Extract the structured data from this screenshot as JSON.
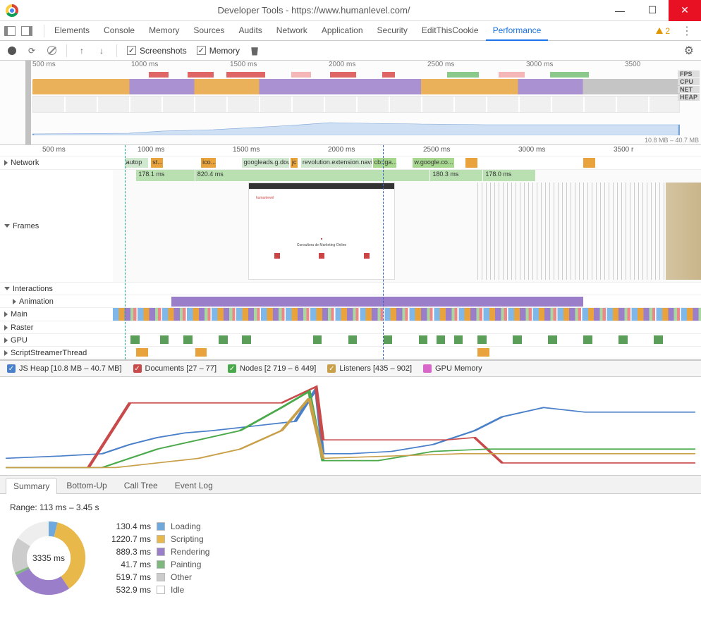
{
  "window": {
    "title": "Developer Tools - https://www.humanlevel.com/"
  },
  "tabs": {
    "items": [
      "Elements",
      "Console",
      "Memory",
      "Sources",
      "Audits",
      "Network",
      "Application",
      "Security",
      "EditThisCookie",
      "Performance"
    ],
    "active": "Performance",
    "warning_count": "2"
  },
  "toolbar": {
    "screenshots_label": "Screenshots",
    "memory_label": "Memory"
  },
  "overview": {
    "ticks": [
      "500 ms",
      "1000 ms",
      "1500 ms",
      "2000 ms",
      "2500 ms",
      "3000 ms",
      "3500"
    ],
    "lanes": [
      "FPS",
      "CPU",
      "NET",
      "HEAP"
    ],
    "heap_range": "10.8 MB – 40.7 MB"
  },
  "flame": {
    "ticks": [
      "500 ms",
      "1000 ms",
      "1500 ms",
      "2000 ms",
      "2500 ms",
      "3000 ms",
      "3500 r"
    ],
    "rows": {
      "network": "Network",
      "frames": "Frames",
      "interactions": "Interactions",
      "animation": "Animation",
      "main": "Main",
      "raster": "Raster",
      "gpu": "GPU",
      "script": "ScriptStreamerThread"
    },
    "network_segs": [
      {
        "l": 2,
        "w": 4,
        "c": "#cfe8cf",
        "t": "autop"
      },
      {
        "l": 6.5,
        "w": 2,
        "c": "#e8a33d",
        "t": "st..."
      },
      {
        "l": 15,
        "w": 2.5,
        "c": "#e8a33d",
        "t": "ico..."
      },
      {
        "l": 22,
        "w": 8,
        "c": "#cfe8cf",
        "t": "googleads.g.doubl"
      },
      {
        "l": 30.2,
        "w": 1.2,
        "c": "#e8a33d",
        "t": "jc"
      },
      {
        "l": 32,
        "w": 12,
        "c": "#cfe8cf",
        "t": "revolution.extension.navigat"
      },
      {
        "l": 44.2,
        "w": 4,
        "c": "#a8d890",
        "t": "cb=ga..."
      },
      {
        "l": 51,
        "w": 7,
        "c": "#a8d890",
        "t": "w.google.co..."
      },
      {
        "l": 60,
        "w": 2,
        "c": "#e8a33d",
        "t": ""
      },
      {
        "l": 80,
        "w": 2,
        "c": "#e8a33d",
        "t": ""
      }
    ],
    "frame_bars": [
      {
        "l": 4,
        "w": 10,
        "t": "178.1 ms"
      },
      {
        "l": 14,
        "w": 40,
        "t": "820.4 ms"
      },
      {
        "l": 54,
        "w": 9,
        "t": "180.3 ms"
      },
      {
        "l": 63,
        "w": 9,
        "t": "178.0 ms"
      }
    ]
  },
  "memory_legend": [
    {
      "color": "#4a7fc9",
      "label": "JS Heap [10.8 MB – 40.7 MB]"
    },
    {
      "color": "#c94a4a",
      "label": "Documents [27 – 77]"
    },
    {
      "color": "#4aa94a",
      "label": "Nodes [2 719 – 6 449]"
    },
    {
      "color": "#c9a04a",
      "label": "Listeners [435 – 902]"
    },
    {
      "color": "#d967c9",
      "label": "GPU Memory",
      "unchecked": true
    }
  ],
  "bottom_tabs": {
    "items": [
      "Summary",
      "Bottom-Up",
      "Call Tree",
      "Event Log"
    ],
    "active": "Summary"
  },
  "summary": {
    "range": "Range: 113 ms – 3.45 s",
    "total": "3335 ms",
    "breakdown": [
      {
        "ms": "130.4 ms",
        "label": "Loading",
        "color": "#6fa8dc"
      },
      {
        "ms": "1220.7 ms",
        "label": "Scripting",
        "color": "#e8b94a"
      },
      {
        "ms": "889.3 ms",
        "label": "Rendering",
        "color": "#9b7ec9"
      },
      {
        "ms": "41.7 ms",
        "label": "Painting",
        "color": "#7fb87f"
      },
      {
        "ms": "519.7 ms",
        "label": "Other",
        "color": "#cccccc"
      },
      {
        "ms": "532.9 ms",
        "label": "Idle",
        "color": "#ffffff"
      }
    ]
  },
  "chart_data": {
    "type": "pie",
    "title": "Summary",
    "total_ms": 3335,
    "series": [
      {
        "name": "Loading",
        "value": 130.4,
        "color": "#6fa8dc"
      },
      {
        "name": "Scripting",
        "value": 1220.7,
        "color": "#e8b94a"
      },
      {
        "name": "Rendering",
        "value": 889.3,
        "color": "#9b7ec9"
      },
      {
        "name": "Painting",
        "value": 41.7,
        "color": "#7fb87f"
      },
      {
        "name": "Other",
        "value": 519.7,
        "color": "#cccccc"
      },
      {
        "name": "Idle",
        "value": 532.9,
        "color": "#ffffff"
      }
    ]
  }
}
